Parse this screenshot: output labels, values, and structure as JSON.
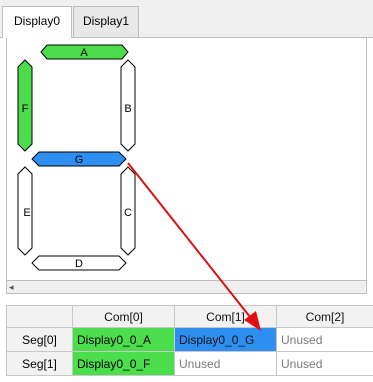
{
  "tabs": [
    {
      "label": "Display0",
      "active": true
    },
    {
      "label": "Display1",
      "active": false
    }
  ],
  "segments": {
    "A": {
      "label": "A",
      "state": "on"
    },
    "B": {
      "label": "B",
      "state": "off"
    },
    "C": {
      "label": "C",
      "state": "off"
    },
    "D": {
      "label": "D",
      "state": "off"
    },
    "E": {
      "label": "E",
      "state": "off"
    },
    "F": {
      "label": "F",
      "state": "on"
    },
    "G": {
      "label": "G",
      "state": "selected"
    }
  },
  "colors": {
    "segment_on": "#4cdd4c",
    "segment_selected": "#2e8ff0",
    "segment_off": "#ffffff",
    "arrow": "#e01010"
  },
  "grid": {
    "columns": [
      "Com[0]",
      "Com[1]",
      "Com[2]"
    ],
    "rows": [
      {
        "header": "Seg[0]",
        "cells": [
          {
            "text": "Display0_0_A",
            "state": "green"
          },
          {
            "text": "Display0_0_G",
            "state": "blue"
          },
          {
            "text": "Unused",
            "state": "unused"
          }
        ]
      },
      {
        "header": "Seg[1]",
        "cells": [
          {
            "text": "Display0_0_F",
            "state": "green"
          },
          {
            "text": "Unused",
            "state": "unused"
          },
          {
            "text": "Unused",
            "state": "unused"
          }
        ]
      }
    ]
  },
  "scrollbar": {
    "left_arrow_icon": "◂"
  }
}
